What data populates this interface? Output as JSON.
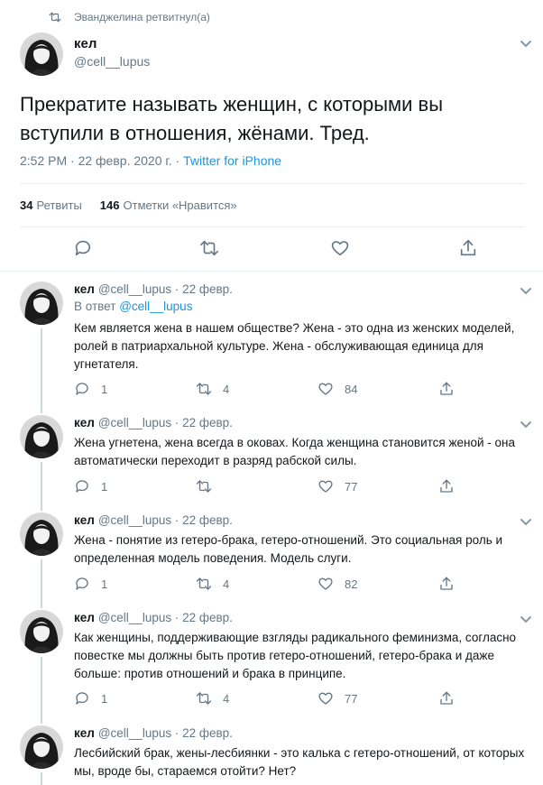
{
  "retweet_context": "Эванджелина ретвитнул(а)",
  "main": {
    "name": "кел",
    "handle": "@cell__lupus",
    "text": "Прекратите называть женщин, с которыми вы вступили в отношения, жёнами. Тред.",
    "time": "2:52 PM · 22 февр. 2020 г. · ",
    "source": "Twitter for iPhone",
    "retweets_count": "34",
    "retweets_label": "Ретвиты",
    "likes_count": "146",
    "likes_label": "Отметки «Нравится»"
  },
  "replies": [
    {
      "name": "кел",
      "meta": "@cell__lupus · 22 февр.",
      "reply_to_label": "В ответ",
      "reply_to_mention": "@cell__lupus",
      "text": "Кем является жена в нашем обществе? Жена - это одна из женских моделей, ролей в патриархальной культуре. Жена - обслуживающая единица для угнетателя.",
      "replies": "1",
      "retweets": "4",
      "likes": "84"
    },
    {
      "name": "кел",
      "meta": "@cell__lupus · 22 февр.",
      "text": "Жена угнетена, жена всегда в оковах. Когда женщина становится женой - она автоматически переходит в разряд рабской силы.",
      "replies": "1",
      "retweets": "",
      "likes": "77"
    },
    {
      "name": "кел",
      "meta": "@cell__lupus · 22 февр.",
      "text": "Жена - понятие из гетеро-брака, гетеро-отношений. Это социальная роль и определенная модель поведения. Модель слуги.",
      "replies": "1",
      "retweets": "4",
      "likes": "82"
    },
    {
      "name": "кел",
      "meta": "@cell__lupus · 22 февр.",
      "text": "Как женщины, поддерживающие взгляды радикального феминизма, согласно повестке мы должны быть против гетеро-отношений, гетеро-брака и даже больше: против отношений и брака в принципе.",
      "replies": "1",
      "retweets": "4",
      "likes": "77"
    },
    {
      "name": "кел",
      "meta": "@cell__lupus · 22 февр.",
      "text": "Лесбийский брак, жены-лесбиянки - это калька с гетеро-отношений, от которых мы, вроде бы, стараемся отойти? Нет?"
    }
  ],
  "colors": {
    "accent": "#1b95e0",
    "muted": "#657786",
    "text": "#14171a",
    "border": "#e6ecf0"
  }
}
